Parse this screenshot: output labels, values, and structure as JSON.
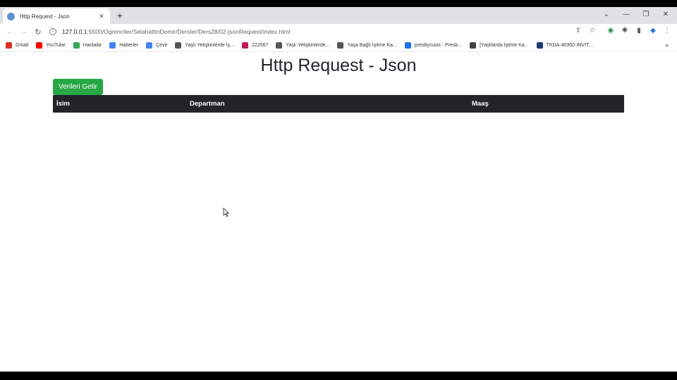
{
  "browser": {
    "tab": {
      "title": "Http Request - Json",
      "close": "✕"
    },
    "new_tab": "+",
    "window": {
      "minimize": "—",
      "restore": "❐",
      "close": "✕",
      "tabsearch": "⌄"
    },
    "nav": {
      "back": "←",
      "forward": "→",
      "reload": "↻",
      "info": "i"
    },
    "url": {
      "host": "127.0.0.1",
      "rest": ":5500/Ogrenciler/SelahattinDemir/Dersler/Ders28/02-jsonRequest/index.html"
    },
    "toolbar_icons": {
      "share": "⇪",
      "star": "☆",
      "ext1": "◉",
      "puzzle": "✱",
      "sidepanel": "▮",
      "shield": "◆",
      "menu": "⋮"
    },
    "bookmarks": [
      {
        "label": "Gmail",
        "color": "#d93025"
      },
      {
        "label": "YouTube",
        "color": "#ff0000"
      },
      {
        "label": "Haritalar",
        "color": "#34a853"
      },
      {
        "label": "Haberler",
        "color": "#4285f4"
      },
      {
        "label": "Çevir",
        "color": "#4285f4"
      },
      {
        "label": "Yaşlı Yetişkinlerde İş...",
        "color": "#555555"
      },
      {
        "label": "222567",
        "color": "#c2185b"
      },
      {
        "label": "Yaşlı Yetişkinlerde...",
        "color": "#555555"
      },
      {
        "label": "Yaşa Bağlı İşitme Ka...",
        "color": "#555555"
      },
      {
        "label": "presbycusis - Presb...",
        "color": "#1a73e8"
      },
      {
        "label": "[Yaşlılarda İşitme Ka...",
        "color": "#444444"
      },
      {
        "label": "TKDA-40350-INVIT...",
        "color": "#1a3a7a"
      }
    ],
    "bookmarks_more": "»"
  },
  "page": {
    "title": "Http Request - Json",
    "fetch_button": "Verileri Getir",
    "table": {
      "headers": [
        "İsim",
        "Departman",
        "Maaş"
      ]
    }
  }
}
